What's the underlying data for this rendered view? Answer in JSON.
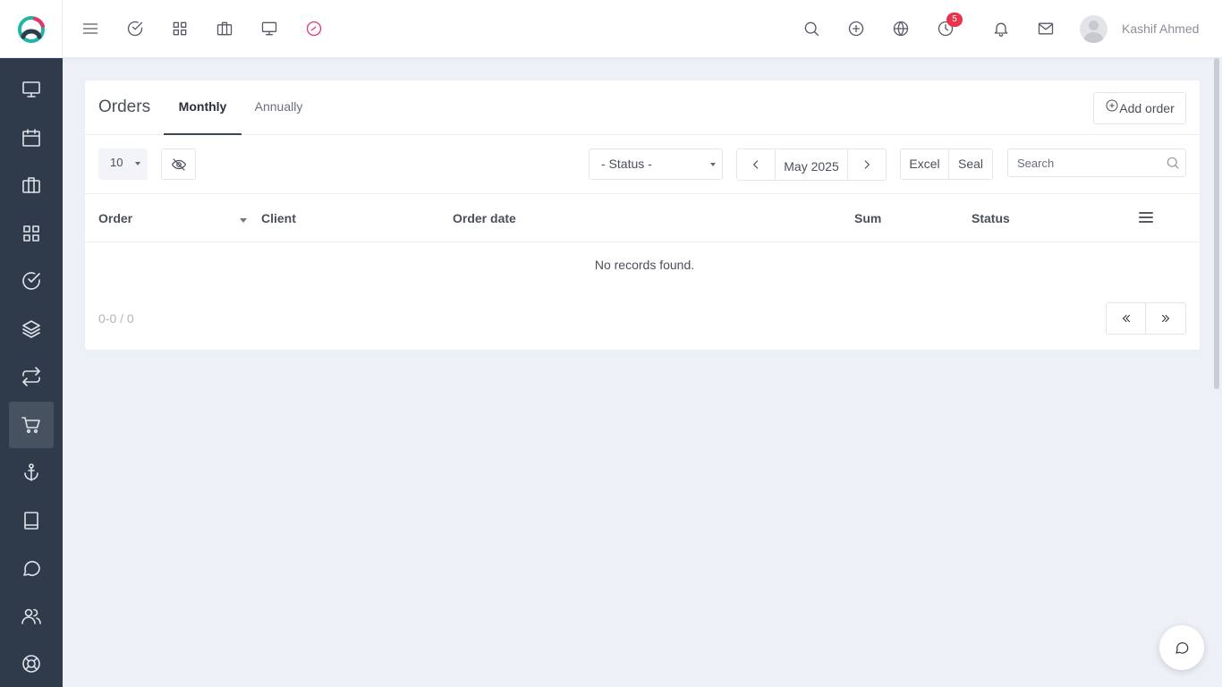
{
  "header": {
    "user_name": "Kashif Ahmed",
    "reminders_badge": "5",
    "left_icons": [
      "menu-icon",
      "check-circle-icon",
      "grid-icon",
      "briefcase-icon",
      "monitor-icon",
      "clock-pink-icon"
    ],
    "right_icons": [
      "search-icon",
      "plus-circle-icon",
      "globe-icon",
      "clock-icon",
      "bell-icon",
      "mail-icon"
    ],
    "accent_color": "#e8346a",
    "badge_color": "#e8354e"
  },
  "sidebar": {
    "items": [
      {
        "icon": "monitor-icon",
        "active": false
      },
      {
        "icon": "calendar-icon",
        "active": false
      },
      {
        "icon": "briefcase-icon",
        "active": false
      },
      {
        "icon": "grid-icon",
        "active": false
      },
      {
        "icon": "check-circle-icon",
        "active": false
      },
      {
        "icon": "layers-icon",
        "active": false
      },
      {
        "icon": "repeat-icon",
        "active": false
      },
      {
        "icon": "cart-icon",
        "active": true
      },
      {
        "icon": "anchor-icon",
        "active": false
      },
      {
        "icon": "book-icon",
        "active": false
      },
      {
        "icon": "message-circle-icon",
        "active": false
      },
      {
        "icon": "users-icon",
        "active": false
      },
      {
        "icon": "life-buoy-icon",
        "active": false
      }
    ],
    "background": "#2f3b4b"
  },
  "orders": {
    "title": "Orders",
    "tabs": [
      {
        "label": "Monthly",
        "active": true
      },
      {
        "label": "Annually",
        "active": false
      }
    ],
    "add_order_label": "Add order",
    "page_size": "10",
    "status_filter": "- Status -",
    "month": "May 2025",
    "export_excel": "Excel",
    "export_seal": "Seal",
    "search_placeholder": "Search",
    "columns": [
      "Order",
      "Client",
      "Order date",
      "Sum",
      "Status"
    ],
    "empty_message": "No records found.",
    "range_text": "0-0 / 0"
  }
}
